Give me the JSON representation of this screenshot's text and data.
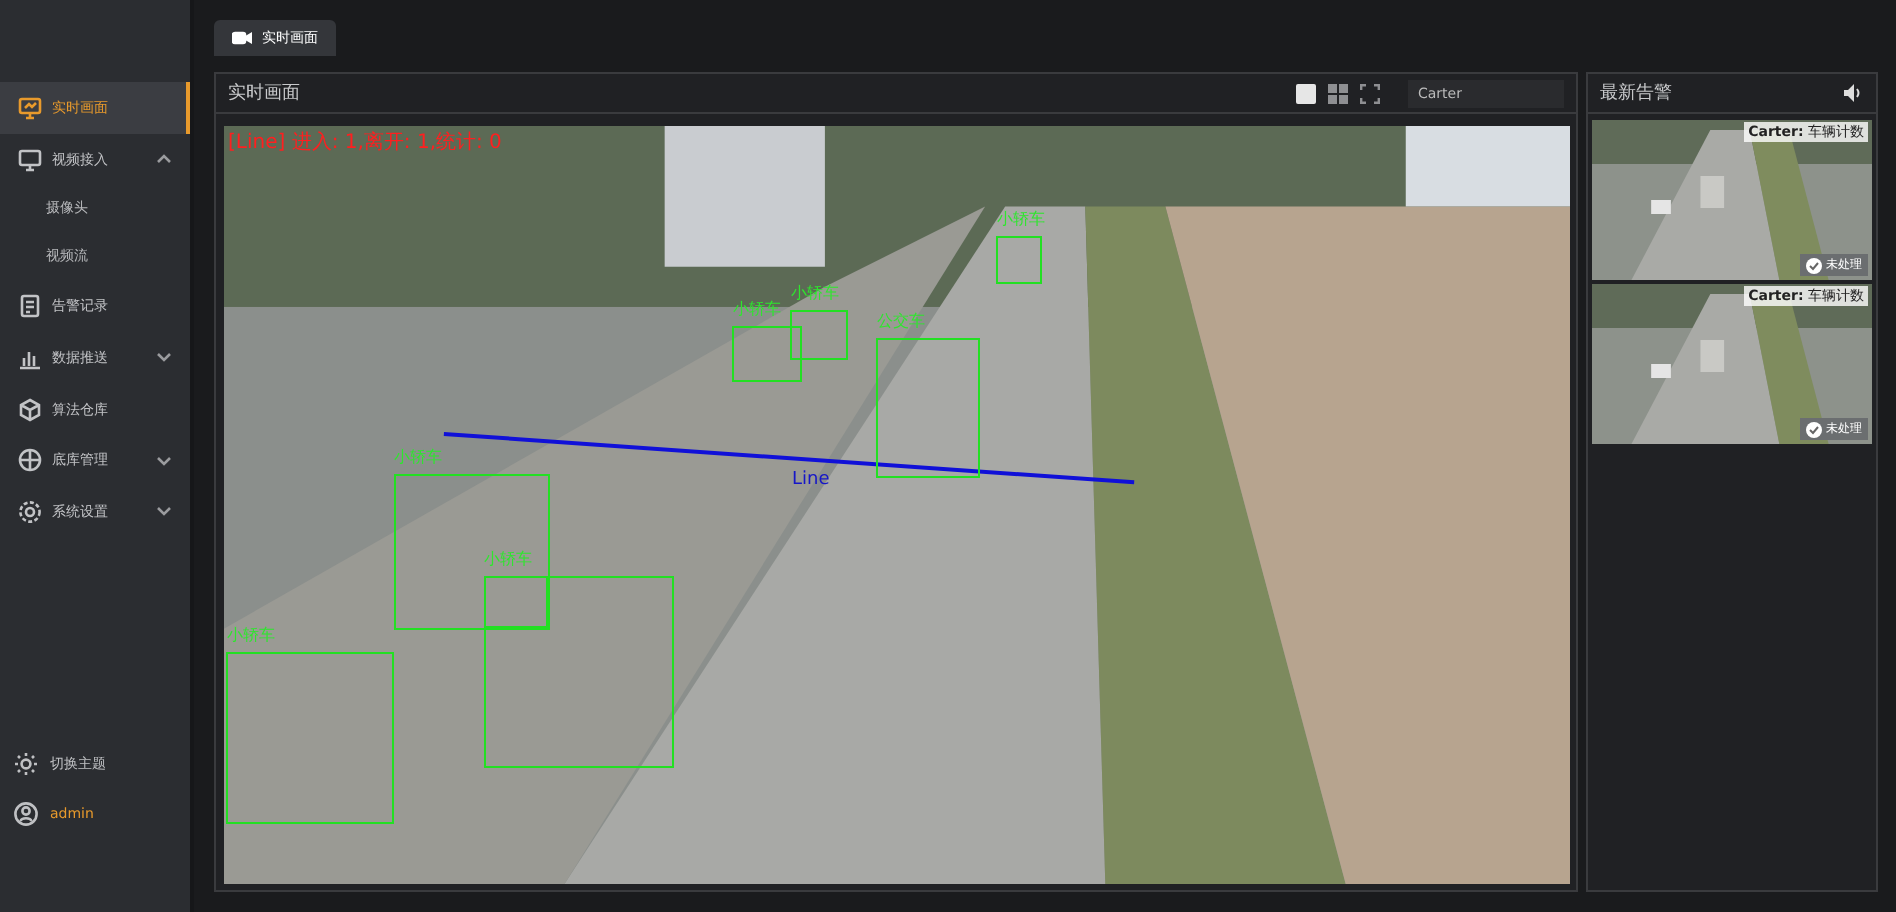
{
  "sidebar": {
    "items": [
      {
        "label": "实时画面",
        "selected": true
      },
      {
        "label": "视频接入",
        "selected": false,
        "expanded": true,
        "children": [
          {
            "label": "摄像头",
            "selected": false
          },
          {
            "label": "视频流",
            "selected": false
          }
        ]
      },
      {
        "label": "告警记录",
        "selected": false
      },
      {
        "label": "数据推送",
        "selected": false,
        "expanded": false
      },
      {
        "label": "算法仓库",
        "selected": false
      },
      {
        "label": "底库管理",
        "selected": false,
        "expanded": false
      },
      {
        "label": "系统设置",
        "selected": false,
        "expanded": false
      }
    ],
    "footer": [
      {
        "label": "切换主题",
        "kind": "theme"
      },
      {
        "label": "admin",
        "kind": "user"
      }
    ]
  },
  "tabs": [
    {
      "label": "实时画面",
      "selected": true
    }
  ],
  "live_panel": {
    "title": "实时画面",
    "view_modes": [
      {
        "selected": true
      },
      {
        "selected": false
      }
    ],
    "search": {
      "value": "Carter"
    },
    "overlay_stats": "[Line] 进入: 1,离开: 1,统计: 0",
    "line_label": "Line",
    "detections": [
      {
        "kind": "labeled",
        "label": "小轿车"
      },
      {
        "kind": "labeled",
        "label": "小轿车"
      },
      {
        "kind": "labeled",
        "label": "小轿车"
      },
      {
        "kind": "labeled",
        "label": "公交车"
      },
      {
        "kind": "labeled",
        "label": "小轿车"
      },
      {
        "kind": "labeled",
        "label": "小轿车"
      },
      {
        "kind": "unlabeled"
      },
      {
        "kind": "labeled",
        "label": "小轿车"
      }
    ]
  },
  "alerts_panel": {
    "title": "最新告警",
    "alerts": [
      {
        "caption": "**Carter:** 车辆计数",
        "status": "未处理",
        "handled": false
      },
      {
        "caption": "**Carter:** 车辆计数",
        "status": "未处理",
        "handled": false
      }
    ]
  }
}
